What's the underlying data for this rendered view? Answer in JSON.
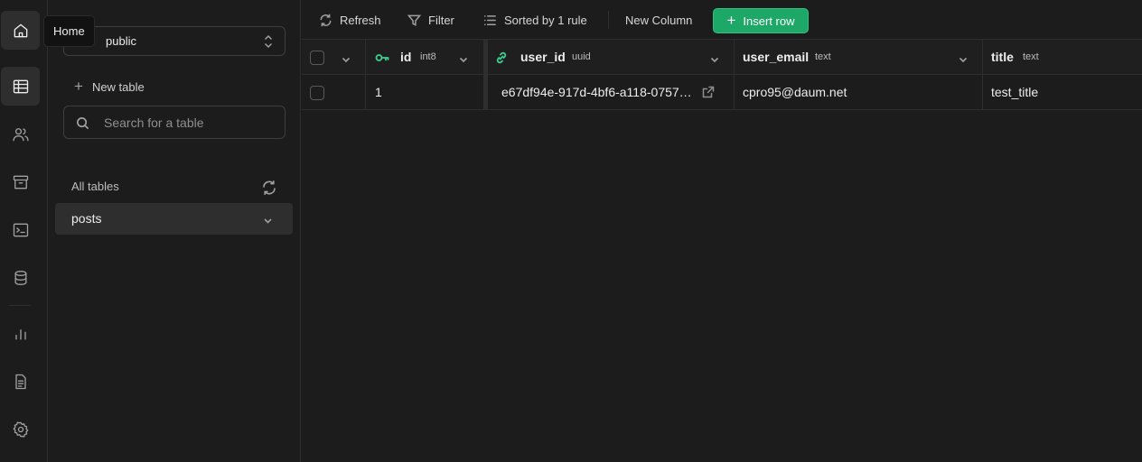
{
  "tooltip": {
    "home": "Home"
  },
  "rail": {
    "icons": [
      "home-icon",
      "table-editor-icon",
      "users-icon",
      "storage-icon",
      "sql-editor-icon",
      "database-icon",
      "reports-icon",
      "docs-icon",
      "settings-icon"
    ],
    "active": "table-editor-icon"
  },
  "sidebar": {
    "schema": "public",
    "new_table": "New table",
    "search_placeholder": "Search for a table",
    "all_tables": "All tables",
    "tables": [
      {
        "name": "posts"
      }
    ]
  },
  "toolbar": {
    "refresh": "Refresh",
    "filter": "Filter",
    "sort": "Sorted by 1 rule",
    "new_column": "New Column",
    "insert_row": "Insert row"
  },
  "grid": {
    "columns": [
      {
        "name": "id",
        "type": "int8",
        "icon": "key-icon"
      },
      {
        "name": "user_id",
        "type": "uuid",
        "icon": "link-icon"
      },
      {
        "name": "user_email",
        "type": "text"
      },
      {
        "name": "title",
        "type": "text"
      }
    ],
    "rows": [
      {
        "id": "1",
        "user_id": "e67df94e-917d-4bf6-a118-0757…",
        "user_email": "cpro95@daum.net",
        "title": "test_title"
      }
    ]
  },
  "colors": {
    "accent": "#3ecf8e",
    "insert_button": "#1ea868",
    "background": "#1c1c1c"
  }
}
